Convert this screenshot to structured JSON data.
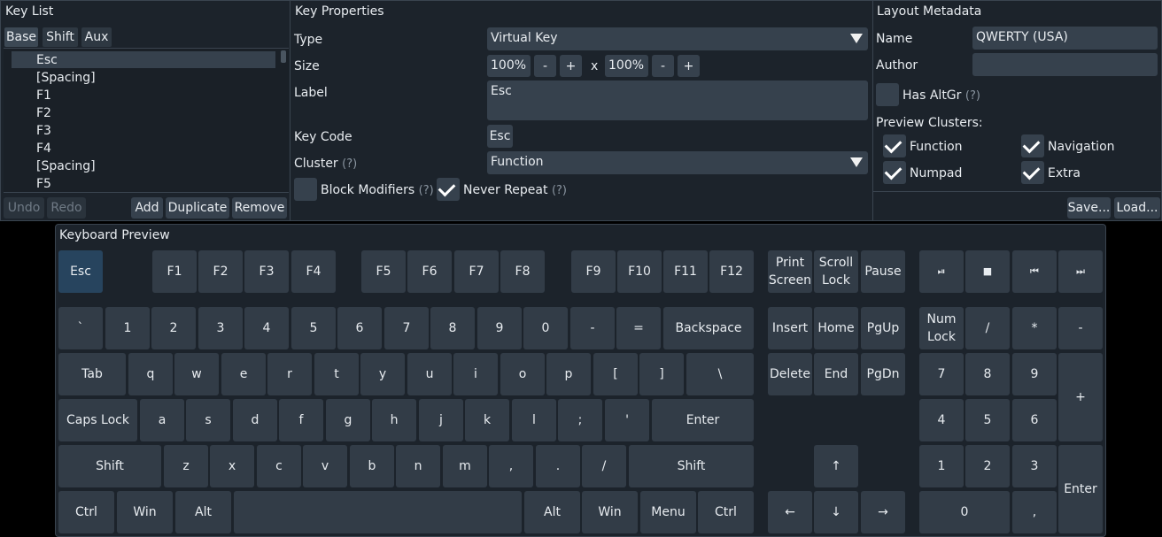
{
  "key_list": {
    "title": "Key List",
    "tabs": [
      "Base",
      "Shift",
      "Aux"
    ],
    "items": [
      "Esc",
      "[Spacing]",
      "F1",
      "F2",
      "F3",
      "F4",
      "[Spacing]",
      "F5"
    ],
    "buttons": {
      "undo": "Undo",
      "redo": "Redo",
      "add": "Add",
      "duplicate": "Duplicate",
      "remove": "Remove"
    }
  },
  "key_properties": {
    "title": "Key Properties",
    "type_label": "Type",
    "type_value": "Virtual Key",
    "size_label": "Size",
    "size_w": "100%",
    "size_h": "100%",
    "size_x": "x",
    "minus": "-",
    "plus": "+",
    "label_label": "Label",
    "label_value": "Esc",
    "keycode_label": "Key Code",
    "keycode_value": "Esc",
    "cluster_label": "Cluster",
    "cluster_hint": "(?)",
    "cluster_value": "Function",
    "block_modifiers": "Block Modifiers",
    "block_modifiers_hint": "(?)",
    "block_modifiers_checked": false,
    "never_repeat": "Never Repeat",
    "never_repeat_hint": "(?)",
    "never_repeat_checked": true
  },
  "layout_metadata": {
    "title": "Layout Metadata",
    "name_label": "Name",
    "name_value": "QWERTY (USA)",
    "author_label": "Author",
    "author_value": "",
    "has_altgr": "Has AltGr",
    "has_altgr_hint": "(?)",
    "has_altgr_checked": false,
    "preview_clusters": "Preview Clusters:",
    "clusters": [
      {
        "label": "Function",
        "checked": true
      },
      {
        "label": "Navigation",
        "checked": true
      },
      {
        "label": "Numpad",
        "checked": true
      },
      {
        "label": "Extra",
        "checked": true
      }
    ],
    "save": "Save...",
    "load": "Load..."
  },
  "keyboard_preview": {
    "title": "Keyboard Preview",
    "selected_key": "Esc"
  },
  "colors": {
    "background": "#000000",
    "panel": "#1c232b",
    "control": "#36414d",
    "key": "#323c47",
    "selected_key": "#27445e"
  }
}
